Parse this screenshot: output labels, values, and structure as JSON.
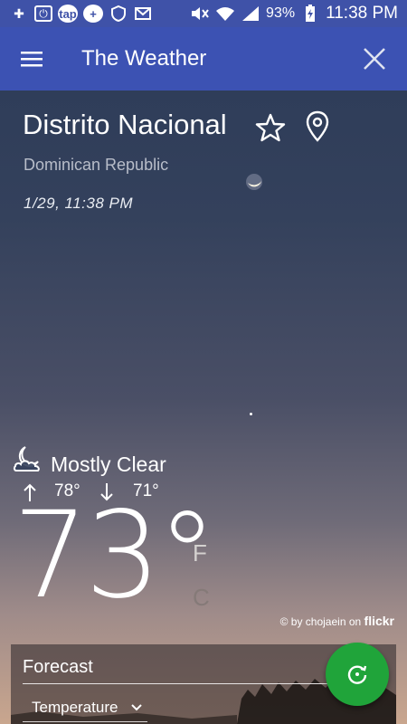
{
  "status_bar": {
    "battery": "93%",
    "time": "11:38 PM",
    "notif_badge_text": "tap"
  },
  "app_bar": {
    "title": "The Weather"
  },
  "location": {
    "city": "Distrito Nacional",
    "country": "Dominican Republic",
    "datetime": "1/29, 11:38 PM"
  },
  "conditions": {
    "summary": "Mostly Clear",
    "high": "78°",
    "low": "71°",
    "temperature": "73°",
    "unit_f": "F",
    "unit_c": "C"
  },
  "photo_credit": {
    "by": "© by chojaein on",
    "site": "flickr"
  },
  "forecast": {
    "title": "Forecast",
    "selected": "Temperature"
  },
  "icons": {
    "menu": "menu-icon",
    "close": "close-icon",
    "favorite": "star-outline-icon",
    "location": "map-pin-icon",
    "condition": "moon-cloud-icon",
    "refresh": "refresh-icon"
  },
  "colors": {
    "app_bar": "#3c52b3",
    "fab": "#20a43a"
  }
}
